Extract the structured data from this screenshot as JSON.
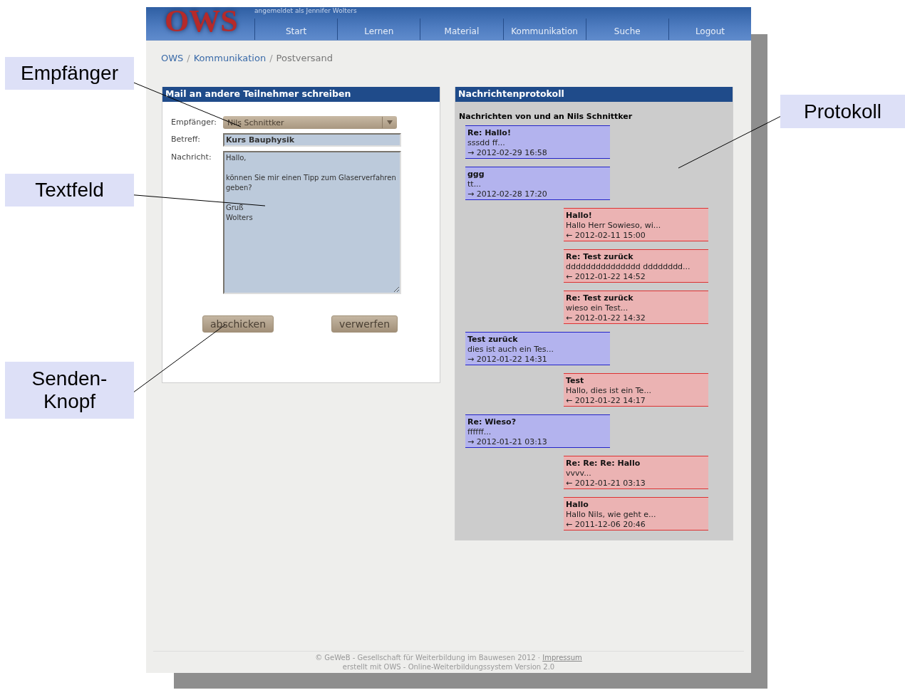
{
  "header": {
    "logo": "OWS",
    "login_note": "angemeldet als Jennifer Wolters",
    "nav": [
      {
        "label": "Start"
      },
      {
        "label": "Lernen"
      },
      {
        "label": "Material"
      },
      {
        "label": "Kommunikation"
      },
      {
        "label": "Suche"
      },
      {
        "label": "Logout"
      }
    ]
  },
  "breadcrumb": [
    {
      "label": "OWS",
      "kind": "link"
    },
    {
      "label": "Kommunikation",
      "kind": "link"
    },
    {
      "label": "Postversand",
      "kind": "current"
    }
  ],
  "breadcrumb_separator": "/",
  "compose": {
    "title": "Mail an andere Teilnehmer schreiben",
    "recipient": {
      "label": "Empfänger:",
      "value": "Nils Schnittker"
    },
    "subject": {
      "label": "Betreff:",
      "value": "Kurs Bauphysik"
    },
    "message": {
      "label": "Nachricht:",
      "value": "Hallo,\n\nkönnen Sie mir einen Tipp zum Glaserverfahren geben?\n\nGruß\nWolters"
    },
    "buttons": [
      "abschicken",
      "verwerfen"
    ]
  },
  "log": {
    "title": "Nachrichtenprotokoll",
    "subtitle": "Nachrichten von und an Nils Schnittker",
    "messages": [
      {
        "kind": "sent",
        "subject": "Re: Hallo!",
        "preview": "sssdd ff...",
        "date": "→ 2012-02-29 16:58"
      },
      {
        "kind": "sent",
        "subject": "ggg",
        "preview": "tt...",
        "date": "→ 2012-02-28 17:20"
      },
      {
        "kind": "received",
        "subject": "Hallo!",
        "preview": "Hallo Herr Sowieso, wi...",
        "date": "← 2012-02-11 15:00"
      },
      {
        "kind": "received",
        "subject": "Re: Test zurück",
        "preview": "ddddddddddddddd dddddddd...",
        "date": "← 2012-01-22 14:52"
      },
      {
        "kind": "received",
        "subject": "Re: Test zurück",
        "preview": "wieso ein Test...",
        "date": "← 2012-01-22 14:32"
      },
      {
        "kind": "sent",
        "subject": "Test zurück",
        "preview": "dies ist auch ein Tes...",
        "date": "→ 2012-01-22 14:31"
      },
      {
        "kind": "received",
        "subject": "Test",
        "preview": "Hallo, dies ist ein Te...",
        "date": "← 2012-01-22 14:17"
      },
      {
        "kind": "sent",
        "subject": "Re: Wieso?",
        "preview": "ffffff...",
        "date": "→ 2012-01-21 03:13"
      },
      {
        "kind": "received",
        "subject": "Re: Re: Re: Hallo",
        "preview": "vvvv...",
        "date": "← 2012-01-21 03:13"
      },
      {
        "kind": "received",
        "subject": "Hallo",
        "preview": "Hallo Nils, wie geht e...",
        "date": "← 2011-12-06 20:46"
      }
    ]
  },
  "footer": {
    "line_1": "© GeWeB - Gesellschaft für Weiterbildung im Bauwesen 2012 ·",
    "impressum": "Impressum",
    "line_2": "erstellt mit OWS - Online-Weiterbildungssystem Version 2.0"
  },
  "callouts": [
    {
      "label": "Empfänger"
    },
    {
      "label": "Textfeld"
    },
    {
      "label": "Senden-Knopf"
    },
    {
      "label": "Protokoll"
    }
  ]
}
